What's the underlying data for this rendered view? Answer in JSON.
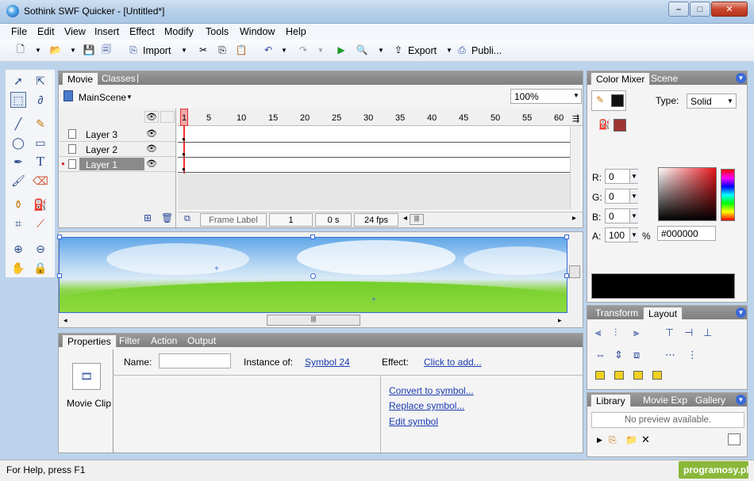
{
  "window": {
    "title": "Sothink SWF Quicker - [Untitled*]"
  },
  "menu": [
    "File",
    "Edit",
    "View",
    "Insert",
    "Effect",
    "Modify",
    "Tools",
    "Window",
    "Help"
  ],
  "toolbar": {
    "import_label": "Import",
    "export_label": "Export",
    "publish_label": "Publi..."
  },
  "movie_panel": {
    "tabs": [
      "Movie",
      "Classes"
    ],
    "scene_name": "MainScene",
    "zoom": "100%",
    "ruler": [
      "1",
      "5",
      "10",
      "15",
      "20",
      "25",
      "30",
      "35",
      "40",
      "45",
      "50",
      "55",
      "60"
    ],
    "layers": [
      "Layer 3",
      "Layer 2",
      "Layer 1"
    ],
    "frame_label_placeholder": "Frame Label",
    "current_frame": "1",
    "time": "0 s",
    "fps": "24 fps"
  },
  "properties_panel": {
    "tabs": [
      "Properties",
      "Filter",
      "Action",
      "Output"
    ],
    "object_type": "Movie Clip",
    "name_label": "Name:",
    "name_value": "",
    "instance_label": "Instance of:",
    "instance_link": "Symbol 24",
    "effect_label": "Effect:",
    "effect_link": "Click to add...",
    "links": [
      "Convert to symbol...",
      "Replace symbol...",
      "Edit symbol"
    ]
  },
  "color_mixer": {
    "tabs": [
      "Color Mixer",
      "Scene"
    ],
    "type_label": "Type:",
    "type_value": "Solid",
    "r_label": "R:",
    "r_value": "0",
    "g_label": "G:",
    "g_value": "0",
    "b_label": "B:",
    "b_value": "0",
    "a_label": "A:",
    "a_value": "100",
    "a_unit": "%",
    "hex_value": "#000000",
    "stroke_color": "#111111",
    "fill_color": "#9e3333"
  },
  "transform_panel": {
    "tabs": [
      "Transform",
      "Layout"
    ]
  },
  "library_panel": {
    "tabs": [
      "Library",
      "Movie Exp",
      "Gallery"
    ],
    "preview_text": "No preview available."
  },
  "status": {
    "help_text": "For Help, press F1",
    "watermark": "programosy.pl"
  }
}
